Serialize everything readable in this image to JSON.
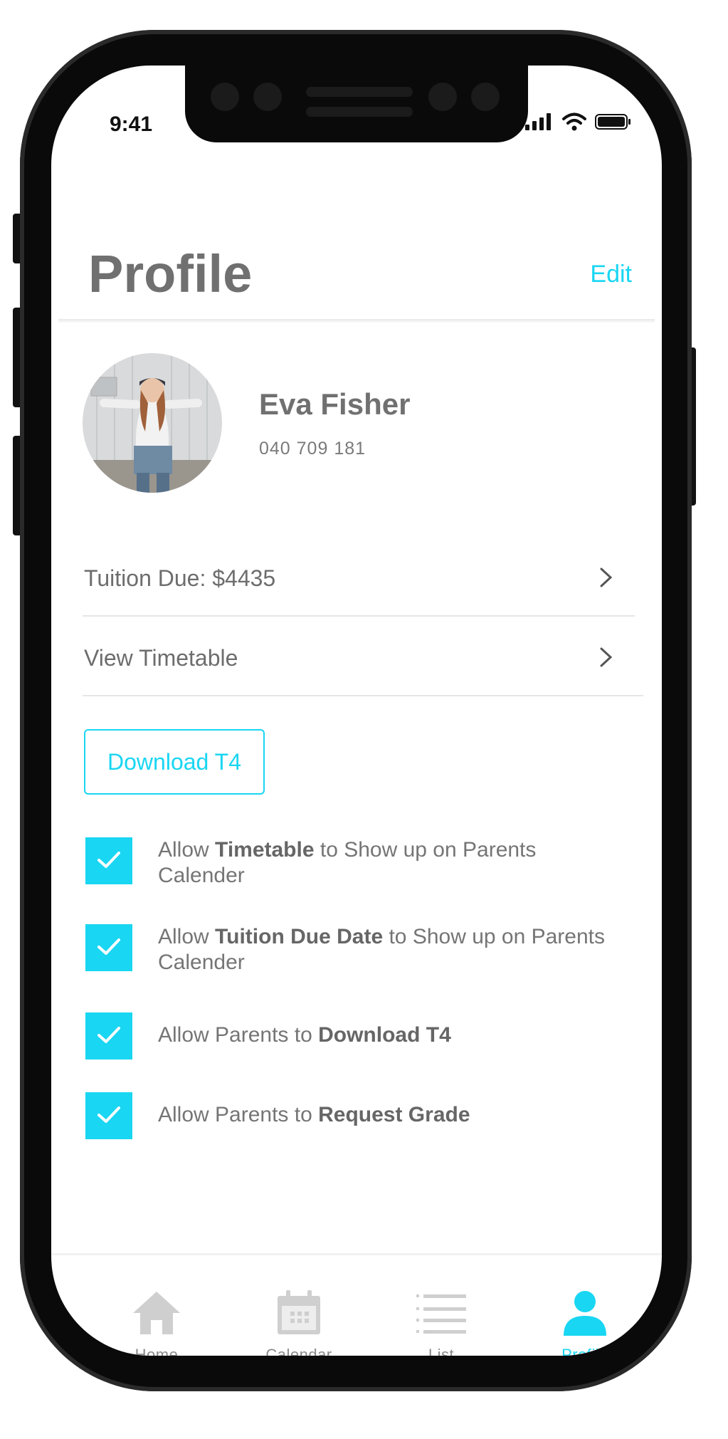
{
  "status_bar": {
    "time": "9:41"
  },
  "header": {
    "title": "Profile",
    "edit_label": "Edit"
  },
  "profile": {
    "name": "Eva Fisher",
    "phone": "040 709 181"
  },
  "rows": [
    {
      "label": "Tuition Due:  $4435"
    },
    {
      "label": "View Timetable"
    }
  ],
  "download_button": {
    "label": "Download T4"
  },
  "permissions": [
    {
      "prefix": "Allow ",
      "bold": "Timetable",
      "suffix": " to Show up on Parents Calender",
      "checked": true
    },
    {
      "prefix": "Allow ",
      "bold": "Tuition Due Date",
      "suffix": " to Show up on Parents Calender",
      "checked": true
    },
    {
      "prefix": "Allow Parents to ",
      "bold": "Download T4",
      "suffix": "",
      "checked": true
    },
    {
      "prefix": "Allow Parents to ",
      "bold": "Request Grade",
      "suffix": "",
      "checked": true
    }
  ],
  "tabs": [
    {
      "label": "Home",
      "icon": "home-icon",
      "active": false
    },
    {
      "label": "Calendar",
      "icon": "calendar-icon",
      "active": false
    },
    {
      "label": "List",
      "icon": "list-icon",
      "active": false
    },
    {
      "label": "Profile",
      "icon": "profile-icon",
      "active": true
    }
  ],
  "colors": {
    "accent": "#19d6f2",
    "text_gray": "#707070",
    "inactive_icon": "#cfcfcf"
  }
}
